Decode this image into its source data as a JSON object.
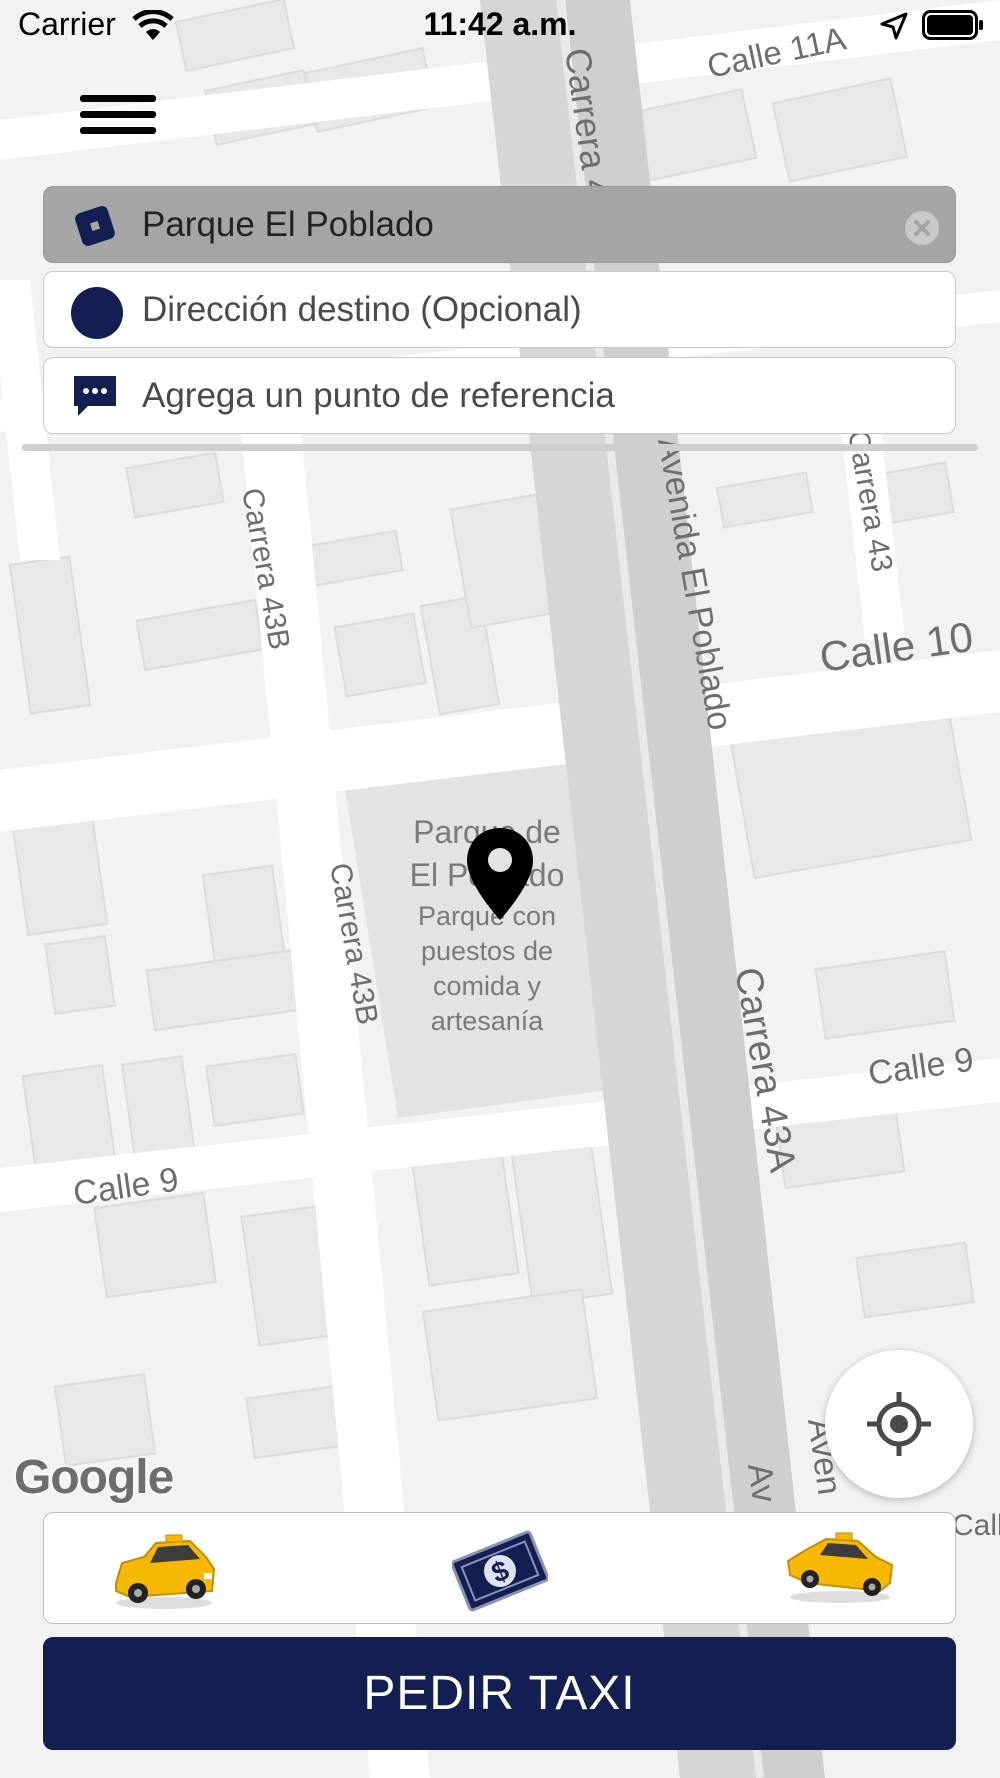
{
  "status_bar": {
    "carrier": "Carrier",
    "time": "11:42 a.m."
  },
  "map": {
    "labels": [
      "Calle 11A",
      "Carrera 43A",
      "Carrera 43B",
      "Avenida El Poblado",
      "Calle 10",
      "Carrera 43",
      "Parque de",
      "El Poblado",
      "Parque con",
      "puestos de",
      "comida y",
      "artesanía",
      "Carrera 43B",
      "Carrera 43A",
      "Calle 9",
      "Calle 9",
      "Aven",
      "Av",
      "Call"
    ],
    "attribution": "Google"
  },
  "origin": {
    "value": "Parque El Poblado"
  },
  "destination": {
    "placeholder": "Dirección destino (Opcional)"
  },
  "reference": {
    "placeholder": "Agrega un punto de referencia"
  },
  "service_options": [
    "taxi-hatchback-icon",
    "cash-payment-icon",
    "taxi-sedan-icon"
  ],
  "order_button": {
    "label": "PEDIR TAXI"
  },
  "colors": {
    "primary": "#131f52",
    "taxi_yellow": "#f6b800"
  }
}
